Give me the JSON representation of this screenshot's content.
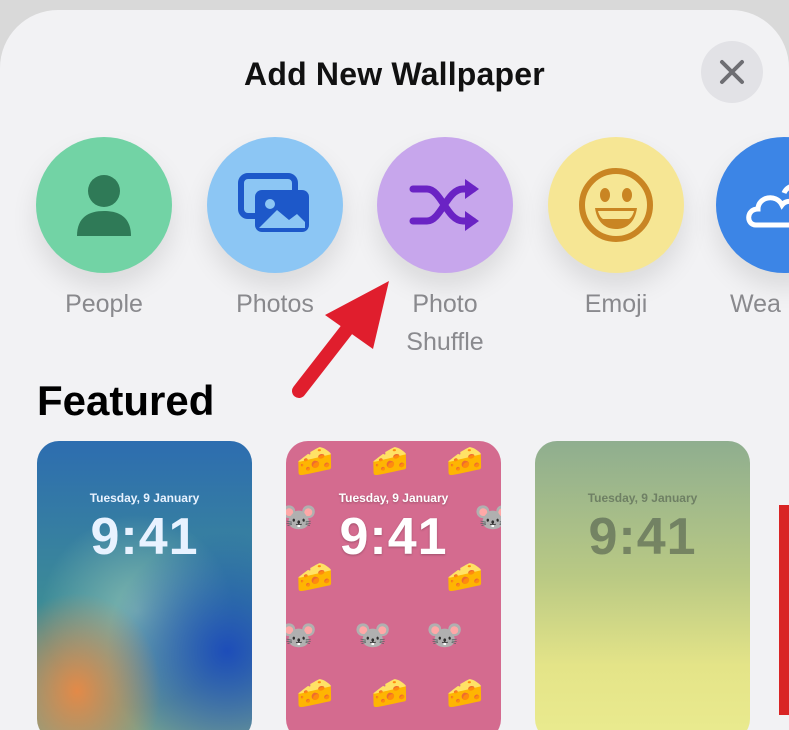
{
  "title": "Add New Wallpaper",
  "close_button": {
    "icon": "close-icon"
  },
  "wallpaper_types": [
    {
      "label": "People",
      "icon": "person-icon",
      "color": "#72d3a5"
    },
    {
      "label": "Photos",
      "icon": "photos-icon",
      "color": "#8cc6f4"
    },
    {
      "label": "Photo Shuffle",
      "icon": "shuffle-icon",
      "color": "#c7a6ec"
    },
    {
      "label": "Emoji",
      "icon": "smiley-icon",
      "color": "#f6e694"
    },
    {
      "label": "Wea",
      "icon": "weather-icon",
      "color": "#3c85e6"
    }
  ],
  "featured": {
    "heading": "Featured",
    "cards": [
      {
        "date": "Tuesday, 9 January",
        "time": "9:41"
      },
      {
        "date": "Tuesday, 9 January",
        "time": "9:41"
      },
      {
        "date": "Tuesday, 9 January",
        "time": "9:41"
      }
    ]
  },
  "annotation": {
    "color": "#e01e2d",
    "icon": "red-arrow-annotation"
  }
}
